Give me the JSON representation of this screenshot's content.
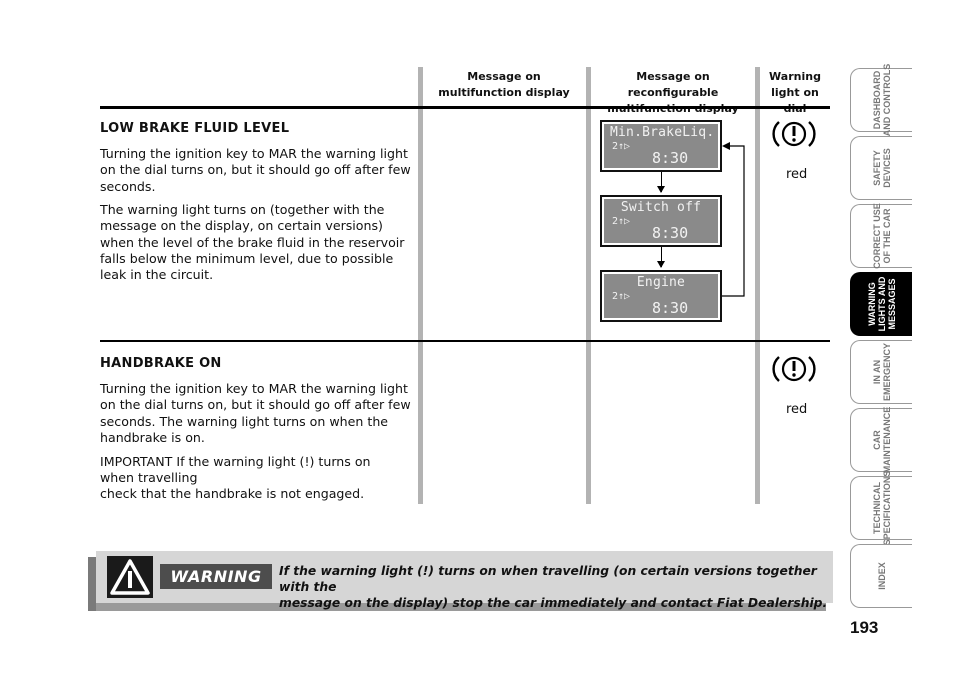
{
  "columns": {
    "multifunction": "Message on multifunction display",
    "reconfigurable": "Message on reconfigurable multifunction display",
    "warning_light": "Warning light on dial"
  },
  "sections": [
    {
      "title": "LOW BRAKE FLUID LEVEL",
      "paragraphs": [
        "Turning the ignition key to MAR the warning light on the dial turns on, but it should go off after few seconds.",
        "The warning light turns on (together with the message on the display, on certain versions) when the level of the brake fluid in the reservoir falls below the minimum level, due to possible leak in the circuit."
      ],
      "light_icon": "brake-warning-icon",
      "light_color": "red",
      "displays": [
        {
          "message": "Min.BrakeLiq.",
          "gear": "2↑▷",
          "time": "8:30"
        },
        {
          "message": "Switch off",
          "gear": "2↑▷",
          "time": "8:30"
        },
        {
          "message": "Engine",
          "gear": "2↑▷",
          "time": "8:30"
        }
      ]
    },
    {
      "title": "HANDBRAKE ON",
      "paragraphs": [
        "Turning the ignition key to MAR the warning light on the dial turns on, but it should go off after few seconds. The warning light turns on when the handbrake is on.",
        "IMPORTANT If the warning light (!) turns on when travelling",
        "check that the handbrake is not engaged."
      ],
      "light_icon": "brake-warning-icon",
      "light_color": "red"
    }
  ],
  "warning": {
    "label": "WARNING",
    "line1": "If the warning light (!) turns on when travelling (on certain versions together with the",
    "line2": "message on the display) stop the car immediately and contact Fiat Dealership."
  },
  "side_tabs": [
    {
      "line1": "DASHBOARD",
      "line2": "AND CONTROLS",
      "active": false
    },
    {
      "line1": "SAFETY",
      "line2": "DEVICES",
      "active": false
    },
    {
      "line1": "CORRECT USE",
      "line2": "OF THE CAR",
      "active": false
    },
    {
      "line1": "WARNING",
      "line2": "LIGHTS AND",
      "line3": "MESSAGES",
      "active": true
    },
    {
      "line1": "IN AN",
      "line2": "EMERGENCY",
      "active": false
    },
    {
      "line1": "CAR",
      "line2": "MAINTENANCE",
      "active": false
    },
    {
      "line1": "TECHNICAL",
      "line2": "SPECIFICATIONS",
      "active": false
    },
    {
      "line1": "INDEX",
      "active": false
    }
  ],
  "page_number": "193"
}
